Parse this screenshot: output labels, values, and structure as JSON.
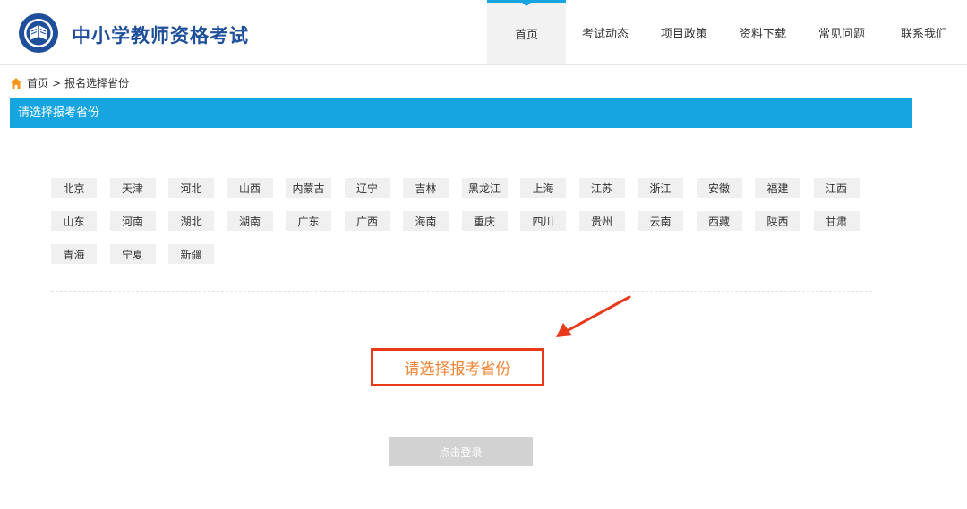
{
  "header": {
    "site_title": "中小学教师资格考试",
    "logo_icon": "exam-center-logo-icon",
    "nav": [
      {
        "label": "首页",
        "active": true
      },
      {
        "label": "考试动态",
        "active": false
      },
      {
        "label": "项目政策",
        "active": false
      },
      {
        "label": "资料下载",
        "active": false
      },
      {
        "label": "常见问题",
        "active": false
      },
      {
        "label": "联系我们",
        "active": false
      }
    ],
    "active_color": "#16a5e0"
  },
  "breadcrumb": {
    "home_icon": "home-icon",
    "home": "首页",
    "separator": ">",
    "current": "报名选择省份"
  },
  "section": {
    "title": "请选择报考省份",
    "color": "#16a5e0"
  },
  "provinces": {
    "rows": [
      [
        "北京",
        "天津",
        "河北",
        "山西",
        "内蒙古",
        "辽宁",
        "吉林",
        "黑龙江",
        "上海",
        "江苏",
        "浙江",
        "安徽",
        "福建",
        "江西"
      ],
      [
        "山东",
        "河南",
        "湖北",
        "湖南",
        "广东",
        "广西",
        "海南",
        "重庆",
        "四川",
        "贵州",
        "云南",
        "西藏",
        "陕西",
        "甘肃"
      ],
      [
        "青海",
        "宁夏",
        "新疆"
      ]
    ]
  },
  "prompt": {
    "text": "请选择报考省份",
    "border_color": "#e8391a",
    "text_color": "#f08536"
  },
  "login": {
    "label": "点击登录"
  }
}
